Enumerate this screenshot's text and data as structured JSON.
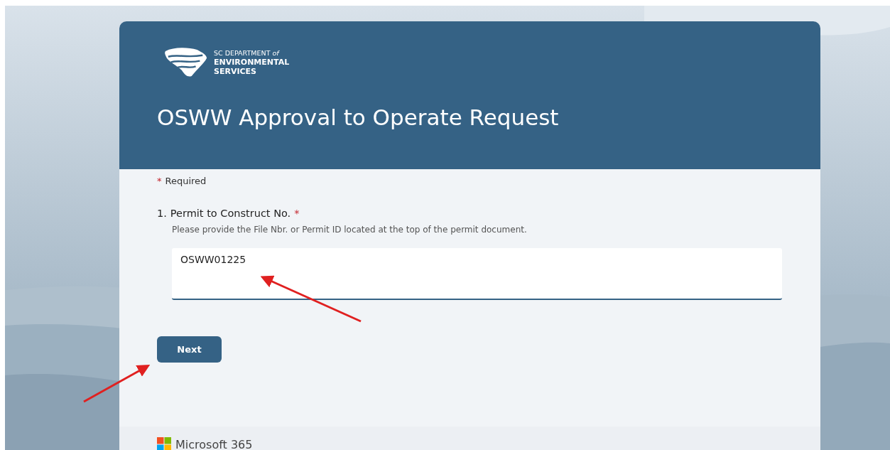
{
  "header": {
    "org_line_1": "SC DEPARTMENT",
    "org_line_1_suffix": "of",
    "org_line_2": "ENVIRONMENTAL",
    "org_line_3": "SERVICES",
    "title": "OSWW Approval to Operate Request"
  },
  "required_note": {
    "mark": "*",
    "text": "Required"
  },
  "question": {
    "number": "1.",
    "label": "Permit to Construct No.",
    "required_mark": "*",
    "description": "Please provide the File Nbr. or Permit ID located at the top of the permit document.",
    "value": "OSWW01225"
  },
  "next_button": "Next",
  "footer": {
    "brand": "Microsoft 365"
  }
}
